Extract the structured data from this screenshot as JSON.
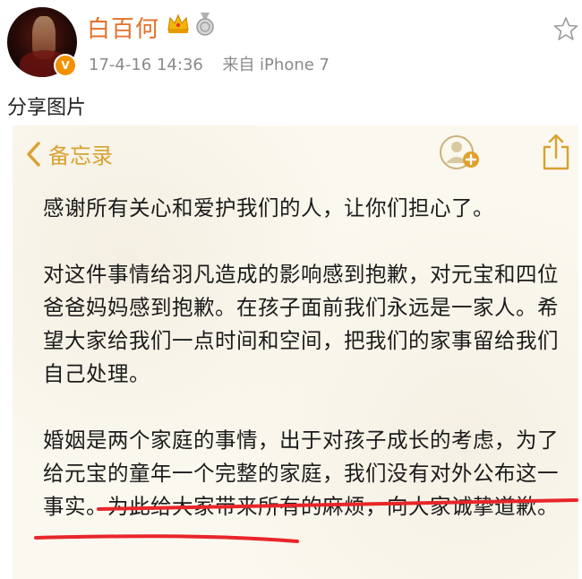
{
  "post": {
    "username": "白百何",
    "timestamp": "17-4-16 14:36",
    "source": "来自 iPhone 7",
    "verify_mark": "V",
    "caption": "分享图片"
  },
  "memo": {
    "back_label": "备忘录",
    "paragraphs": [
      "感谢所有关心和爱护我们的人，让你们担心了。",
      "对这件事情给羽凡造成的影响感到抱歉，对元宝和四位爸爸妈妈感到抱歉。在孩子面前我们永远是一家人。希望大家给我们一点时间和空间，把我们的家事留给我们自己处理。",
      "婚姻是两个家庭的事情，出于对孩子成长的考虑，为了给元宝的童年一个完整的家庭，我们没有对外公布这一事实。为此给大家带来所有的麻烦，向大家诚挚道歉。"
    ]
  },
  "colors": {
    "username": "#e4702a",
    "memo_accent": "#d9a232",
    "highlight_underline": "#e8262a"
  },
  "icons": [
    "crown-icon",
    "medal-icon",
    "star-icon",
    "chevron-left-icon",
    "person-plus-icon",
    "share-icon"
  ]
}
